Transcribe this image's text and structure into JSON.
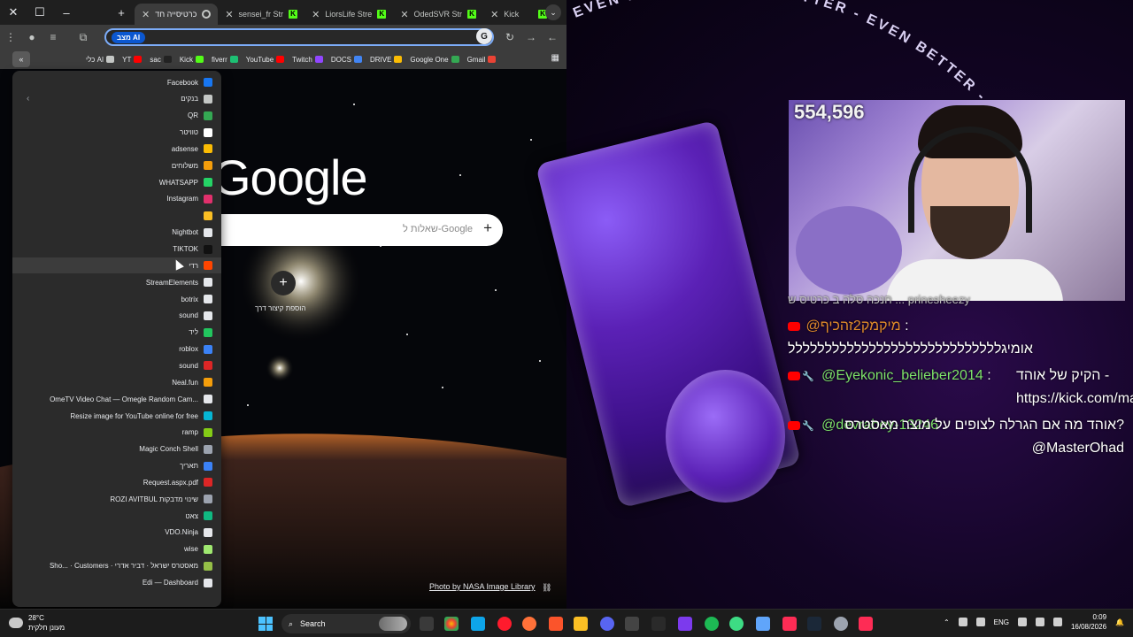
{
  "browser": {
    "tabs": [
      {
        "title": "כרטיסייה חד",
        "active": true
      },
      {
        "title": "sensei_fr Str",
        "active": false
      },
      {
        "title": "LiorsLife Stre",
        "active": false
      },
      {
        "title": "OdedSVR Str",
        "active": false
      },
      {
        "title": "Kick",
        "active": false
      }
    ],
    "omnibox": {
      "ai_chip": "מצב AI"
    },
    "bookmarks": [
      {
        "label": "כלי AI",
        "icon": "folder-icon",
        "color": "#c4c7c5"
      },
      {
        "label": "YT",
        "icon": "youtube-icon",
        "color": "#ff0000"
      },
      {
        "label": "sac",
        "icon": "site-icon",
        "color": "#222222"
      },
      {
        "label": "Kick",
        "icon": "kick-icon",
        "color": "#53fc18"
      },
      {
        "label": "fiverr",
        "icon": "fiverr-icon",
        "color": "#1dbf73"
      },
      {
        "label": "YouTube",
        "icon": "youtube-icon",
        "color": "#ff0000"
      },
      {
        "label": "Twitch",
        "icon": "twitch-icon",
        "color": "#9146ff"
      },
      {
        "label": "DOCS",
        "icon": "docs-icon",
        "color": "#4285f4"
      },
      {
        "label": "DRIVE",
        "icon": "drive-icon",
        "color": "#fbbc04"
      },
      {
        "label": "Google One",
        "icon": "google-one-icon",
        "color": "#34a853"
      },
      {
        "label": "Gmail",
        "icon": "gmail-icon",
        "color": "#ea4335"
      }
    ],
    "ntp": {
      "logo": "Google",
      "search_placeholder": "שאלות ל-Google",
      "shortcut_label": "הוספת קיצור דרך",
      "photo_credit": "Photo by NASA Image Library"
    },
    "dropdown_items": [
      {
        "label": "Facebook",
        "icon": "facebook-icon",
        "color": "#1877f2"
      },
      {
        "label": "בנקים",
        "icon": "folder-icon",
        "color": "#c4c7c5"
      },
      {
        "label": "QR",
        "icon": "qr-icon",
        "color": "#34a853"
      },
      {
        "label": "טוויטר",
        "icon": "x-icon",
        "color": "#ffffff"
      },
      {
        "label": "adsense",
        "icon": "adsense-icon",
        "color": "#fbbc04"
      },
      {
        "label": "משלוחים",
        "icon": "delivery-icon",
        "color": "#f59e0b"
      },
      {
        "label": "WHATSAPP",
        "icon": "whatsapp-icon",
        "color": "#25d366"
      },
      {
        "label": "Instagram",
        "icon": "instagram-icon",
        "color": "#e1306c"
      },
      {
        "label": "",
        "icon": "emoji-icon",
        "color": "#fbbf24"
      },
      {
        "label": "Nightbot",
        "icon": "nightbot-icon",
        "color": "#e5e7eb"
      },
      {
        "label": "TIKTOK",
        "icon": "tiktok-icon",
        "color": "#111111"
      },
      {
        "label": "רדי",
        "icon": "reddit-icon",
        "color": "#ff4500"
      },
      {
        "label": "StreamElements",
        "icon": "streamelements-icon",
        "color": "#e5e7eb"
      },
      {
        "label": "botrix",
        "icon": "botrix-icon",
        "color": "#e5e7eb"
      },
      {
        "label": "sound",
        "icon": "sound-icon",
        "color": "#e5e7eb"
      },
      {
        "label": "ליד",
        "icon": "lead-icon",
        "color": "#22c55e"
      },
      {
        "label": "roblox",
        "icon": "roblox-icon",
        "color": "#3b82f6"
      },
      {
        "label": "sound",
        "icon": "sound-icon",
        "color": "#dc2626"
      },
      {
        "label": "Neal.fun",
        "icon": "nealfun-icon",
        "color": "#f59e0b"
      },
      {
        "label": "OmeTV Video Chat — Omegle Random Cam...",
        "icon": "ometv-icon",
        "color": "#e5e7eb"
      },
      {
        "label": "Resize image for YouTube online for free",
        "icon": "resize-icon",
        "color": "#06b6d4"
      },
      {
        "label": "ramp",
        "icon": "ramp-icon",
        "color": "#84cc16"
      },
      {
        "label": "Magic Conch Shell",
        "icon": "conch-icon",
        "color": "#9ca3af"
      },
      {
        "label": "תאריך",
        "icon": "calendar-icon",
        "color": "#3b82f6"
      },
      {
        "label": "Request.aspx.pdf",
        "icon": "pdf-icon",
        "color": "#dc2626"
      },
      {
        "label": "ROZI AVITBUL שינוי מדבקות",
        "icon": "site-icon",
        "color": "#9ca3af"
      },
      {
        "label": "צאט",
        "icon": "chat-icon",
        "color": "#10b981"
      },
      {
        "label": "VDO.Ninja",
        "icon": "vdoninja-icon",
        "color": "#e5e7eb"
      },
      {
        "label": "wise",
        "icon": "wise-icon",
        "color": "#9fe870"
      },
      {
        "label": "Sho... · Customers · מאסטרס ישראל · דביר אדרי",
        "icon": "shopify-icon",
        "color": "#95bf47"
      },
      {
        "label": "Edi — Dashboard",
        "icon": "dashboard-icon",
        "color": "#e5e7eb"
      }
    ]
  },
  "stream": {
    "viewer_count": "554,596",
    "ring_text": "EVEN BETTER - EVEN BETTER - EVEN BETTER - EVEN",
    "chat": [
      {
        "platform": "youtube",
        "user": "@מיקמק2זהכיף",
        "sep": " :",
        "message": "",
        "user_color": "#e08a2c"
      },
      {
        "platform": "",
        "user": "",
        "sep": "",
        "message": "אומיגללללללללללללללללללללללללללללל",
        "user_color": "#ffffff"
      },
      {
        "platform": "youtube",
        "user": "@Eyekonic_belieber2014",
        "sep": " : ",
        "message": "הקיק של אוהד - https://kick.com/maste..",
        "user_color": "#7ee36b"
      },
      {
        "platform": "youtube",
        "user": "@devraboy-13246",
        "sep": " : ",
        "message": "אוהד מה אם הגרלה לצופים על מוצר מאסטרס? @MasterOhad",
        "user_color": "#7ee36b"
      }
    ],
    "chat_partial_top": "חנכה סלה ב כרטיס ש ... prinesheezy"
  },
  "taskbar": {
    "weather_temp": "28°C",
    "weather_desc": "מעונן חלקית",
    "search_placeholder": "Search",
    "language": "ENG",
    "time": "0:09",
    "date": "16/08/2026"
  }
}
